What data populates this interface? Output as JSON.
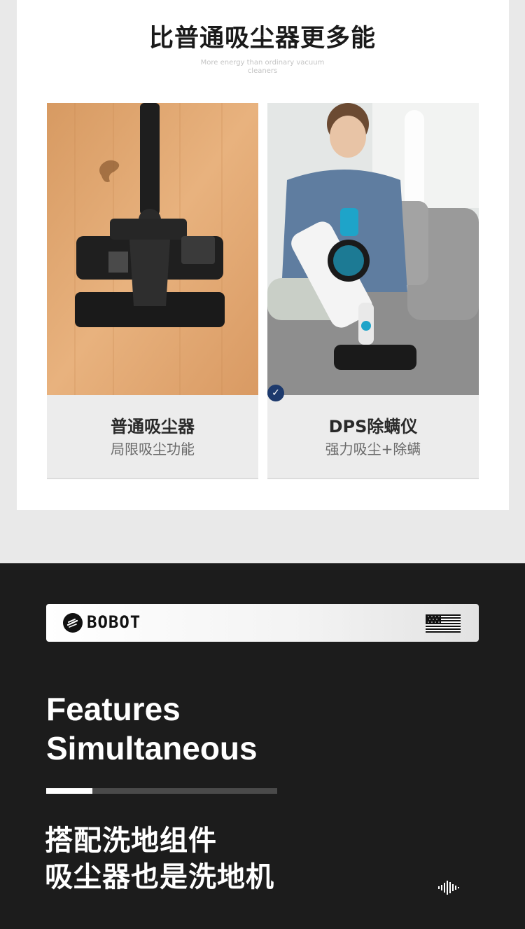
{
  "header": {
    "title": "比普通吸尘器更多能",
    "subtitle_line1": "More energy than ordinary vacuum",
    "subtitle_line2": "cleaners"
  },
  "comparison": [
    {
      "title": "普通吸尘器",
      "subtitle": "局限吸尘功能",
      "selected": false
    },
    {
      "title": "DPS除螨仪",
      "subtitle": "强力吸尘+除螨",
      "selected": true
    }
  ],
  "brand": {
    "name": "BOBOT",
    "flag_icon": "us-flag-icon"
  },
  "feature": {
    "line1": "Features",
    "line2": "Simultaneous",
    "progress": 0.2
  },
  "tagline": {
    "line1": "搭配洗地组件",
    "line2": "吸尘器也是洗地机"
  },
  "colors": {
    "dark_bg": "#1c1c1c",
    "check_badge": "#1d3a6d",
    "accent_teal": "#1ea4c9"
  }
}
